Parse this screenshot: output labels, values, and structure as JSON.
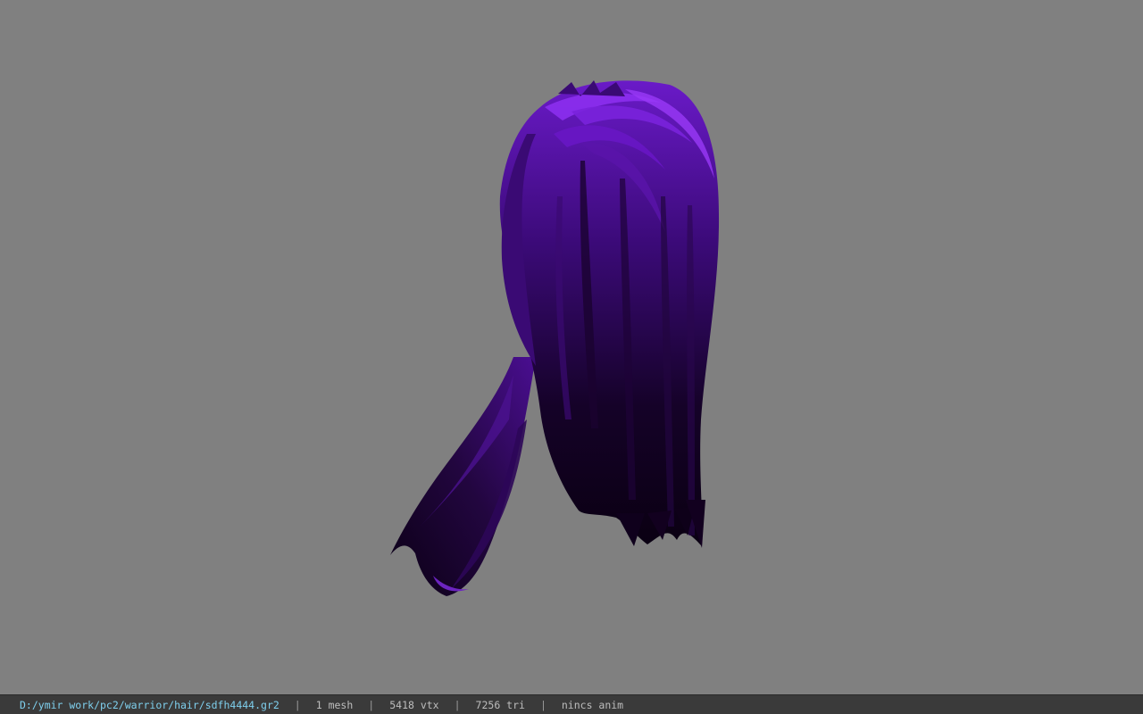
{
  "viewport": {
    "background": "#808080",
    "model": "hair-mesh",
    "model_color": "#5a12a8"
  },
  "status": {
    "file_path": "D:/ymir work/pc2/warrior/hair/sdfh4444.gr2",
    "separator": "|",
    "mesh": "1 mesh",
    "vertices": "5418 vtx",
    "triangles": "7256 tri",
    "anim": "nincs anim"
  }
}
